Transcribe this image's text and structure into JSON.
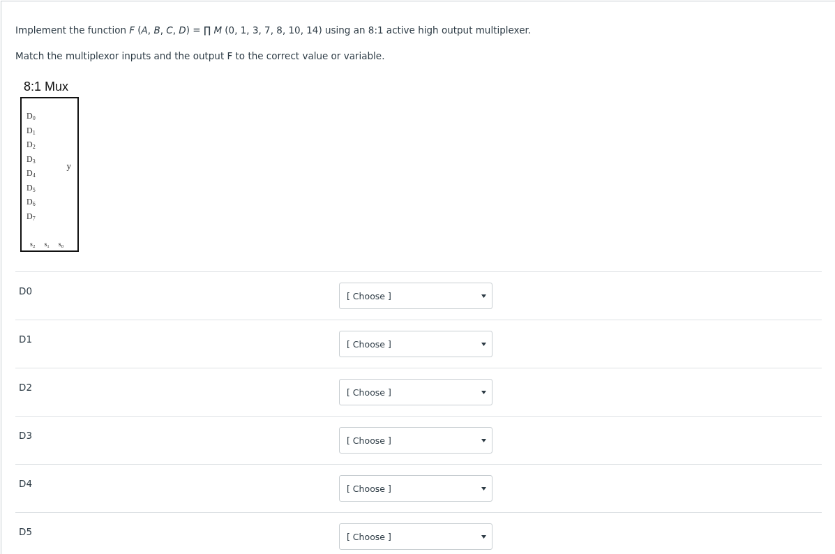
{
  "question": "Implement the function *F* (*A*, *B*, *C*, *D*) = ∏ *M* (0, 1, 3, 7, 8, 10, 14) using an 8:1 active high output multiplexer.",
  "instruction": "Match the multiplexor inputs and the output F to the correct value or variable.",
  "mux": {
    "title": "8:1 Mux",
    "inputs": [
      "D$_{0}$",
      "D$_{1}$",
      "D$_{2}$",
      "D$_{3}$",
      "D$_{4}$",
      "D$_{5}$",
      "D$_{6}$",
      "D$_{7}$"
    ],
    "output": "y",
    "selects": [
      "s$_{2}$",
      "s$_{1}$",
      "s$_{0}$"
    ]
  },
  "matches": [
    {
      "label": "D0",
      "value": "[ Choose ]"
    },
    {
      "label": "D1",
      "value": "[ Choose ]"
    },
    {
      "label": "D2",
      "value": "[ Choose ]"
    },
    {
      "label": "D3",
      "value": "[ Choose ]"
    },
    {
      "label": "D4",
      "value": "[ Choose ]"
    },
    {
      "label": "D5",
      "value": "[ Choose ]"
    }
  ]
}
